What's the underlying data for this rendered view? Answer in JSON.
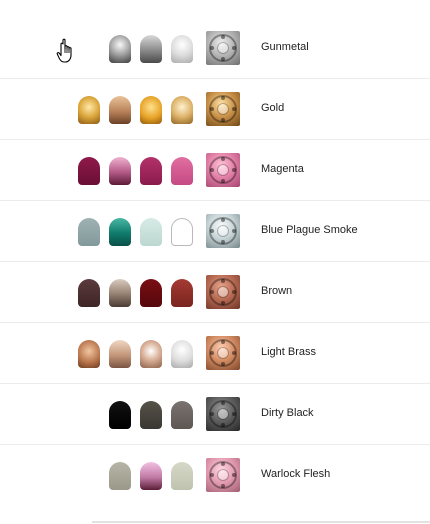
{
  "rows": [
    {
      "name": "Gunmetal",
      "pots": [
        null,
        {
          "fill": "radial-gradient(circle at 50% 35%, #f7f7f7 0%, #a5a5a5 45%, #3b3b3b 100%)"
        },
        {
          "fill": "linear-gradient(180deg, #d9d9d9 0%, #8a8a8a 55%, #4a4a4a 100%)"
        },
        {
          "fill": "radial-gradient(circle at 50% 35%, #ffffff 0%, #dcdcdc 50%, #a9a9a9 100%)"
        }
      ],
      "mini": {
        "fill": "radial-gradient(circle at 45% 35%, #ededed 0%, #b4b4b4 45%, #6d6d6d 100%)"
      }
    },
    {
      "name": "Gold",
      "pots": [
        {
          "fill": "radial-gradient(circle at 50% 40%, #ffe9a8 0%, #dba63c 50%, #8a5a14 100%)"
        },
        {
          "fill": "linear-gradient(180deg, #e9c39a 0%, #b9825a 55%, #6a4126 100%)"
        },
        {
          "fill": "radial-gradient(circle at 50% 40%, #ffe08d 0%, #e6a226 55%, #8f5a0b 100%)"
        },
        {
          "fill": "radial-gradient(circle at 50% 40%, #fff1cf 0%, #ddb36a 50%, #8d6221 100%)"
        }
      ],
      "mini": {
        "fill": "radial-gradient(circle at 45% 35%, #ffe2a6 0%, #c99148 45%, #6e4716 100%)"
      }
    },
    {
      "name": "Magenta",
      "pots": [
        {
          "fill": "linear-gradient(180deg, #8f1a4a 0%, #6a0f35 100%)"
        },
        {
          "fill": "linear-gradient(180deg, #f0b2cf 0%, #b25a86 55%, #5b1a36 100%)"
        },
        {
          "fill": "linear-gradient(180deg, #b2326a 0%, #8b1b4d 100%)"
        },
        {
          "fill": "linear-gradient(180deg, #e06ea1 0%, #c64a83 100%)"
        }
      ],
      "mini": {
        "fill": "radial-gradient(circle at 45% 35%, #ffc2d7 0%, #e27fa6 45%, #a44470 100%)"
      }
    },
    {
      "name": "Blue Plague Smoke",
      "pots": [
        {
          "fill": "linear-gradient(180deg, #9fb2b3 0%, #82999b 100%)"
        },
        {
          "fill": "linear-gradient(180deg, #4ab6a3 0%, #0f7b6c 55%, #0a4f47 100%)"
        },
        {
          "fill": "linear-gradient(180deg, #d7ebe6 0%, #bcd7d0 100%)"
        },
        {
          "fill": "#ffffff",
          "outlined": true
        }
      ],
      "mini": {
        "fill": "radial-gradient(circle at 45% 35%, #f7fbfb 0%, #c6d3d6 45%, #758587 100%)"
      }
    },
    {
      "name": "Brown",
      "pots": [
        {
          "fill": "linear-gradient(180deg, #5b3a3b 0%, #3e2526 100%)"
        },
        {
          "fill": "linear-gradient(180deg, #d8cbbf 0%, #9b8677 50%, #4b3b33 100%)"
        },
        {
          "fill": "linear-gradient(180deg, #7a0f14 0%, #55080c 100%)"
        },
        {
          "fill": "linear-gradient(180deg, #a43b33 0%, #7a241f 100%)"
        }
      ],
      "mini": {
        "fill": "radial-gradient(circle at 45% 35%, #e7a48c 0%, #b76a52 45%, #6d3528 100%)"
      }
    },
    {
      "name": "Light Brass",
      "pots": [
        {
          "fill": "radial-gradient(circle at 50% 40%, #f1c7a2 0%, #b9764d 55%, #6c3a1e 100%)"
        },
        {
          "fill": "linear-gradient(180deg, #f0d7c4 0%, #c29678 55%, #7a5443 100%)"
        },
        {
          "fill": "radial-gradient(circle at 50% 40%, #ffffff 0%, #d9b098 45%, #8b5f47 100%)"
        },
        {
          "fill": "radial-gradient(circle at 50% 35%, #ffffff 0%, #dcdcdc 55%, #a7a7a7 100%)"
        }
      ],
      "mini": {
        "fill": "radial-gradient(circle at 45% 35%, #ffd0b4 0%, #d38c63 45%, #7e4629 100%)"
      }
    },
    {
      "name": "Dirty Black",
      "pots": [
        null,
        {
          "fill": "linear-gradient(180deg, #121212 0%, #000000 100%)"
        },
        {
          "fill": "linear-gradient(180deg, #565249 0%, #3b3833 100%)"
        },
        {
          "fill": "linear-gradient(180deg, #7a7370 0%, #5d5653 100%)"
        }
      ],
      "mini": {
        "fill": "radial-gradient(circle at 45% 35%, #9a9a9a 0%, #5d5d5d 45%, #262626 100%)"
      }
    },
    {
      "name": "Warlock Flesh",
      "pots": [
        null,
        {
          "fill": "linear-gradient(180deg, #b6b4a6 0%, #9b998a 100%)"
        },
        {
          "fill": "linear-gradient(180deg, #f2c1e1 0%, #c07aa5 55%, #5a1d35 100%)"
        },
        {
          "fill": "linear-gradient(180deg, #d6d8c8 0%, #bfc3ae 100%)"
        }
      ],
      "mini": {
        "fill": "radial-gradient(circle at 45% 35%, #ffd7e3 0%, #e39bb1 45%, #9f5d70 100%)"
      }
    }
  ],
  "cursor": {
    "icon": "hand-pointer-icon"
  }
}
